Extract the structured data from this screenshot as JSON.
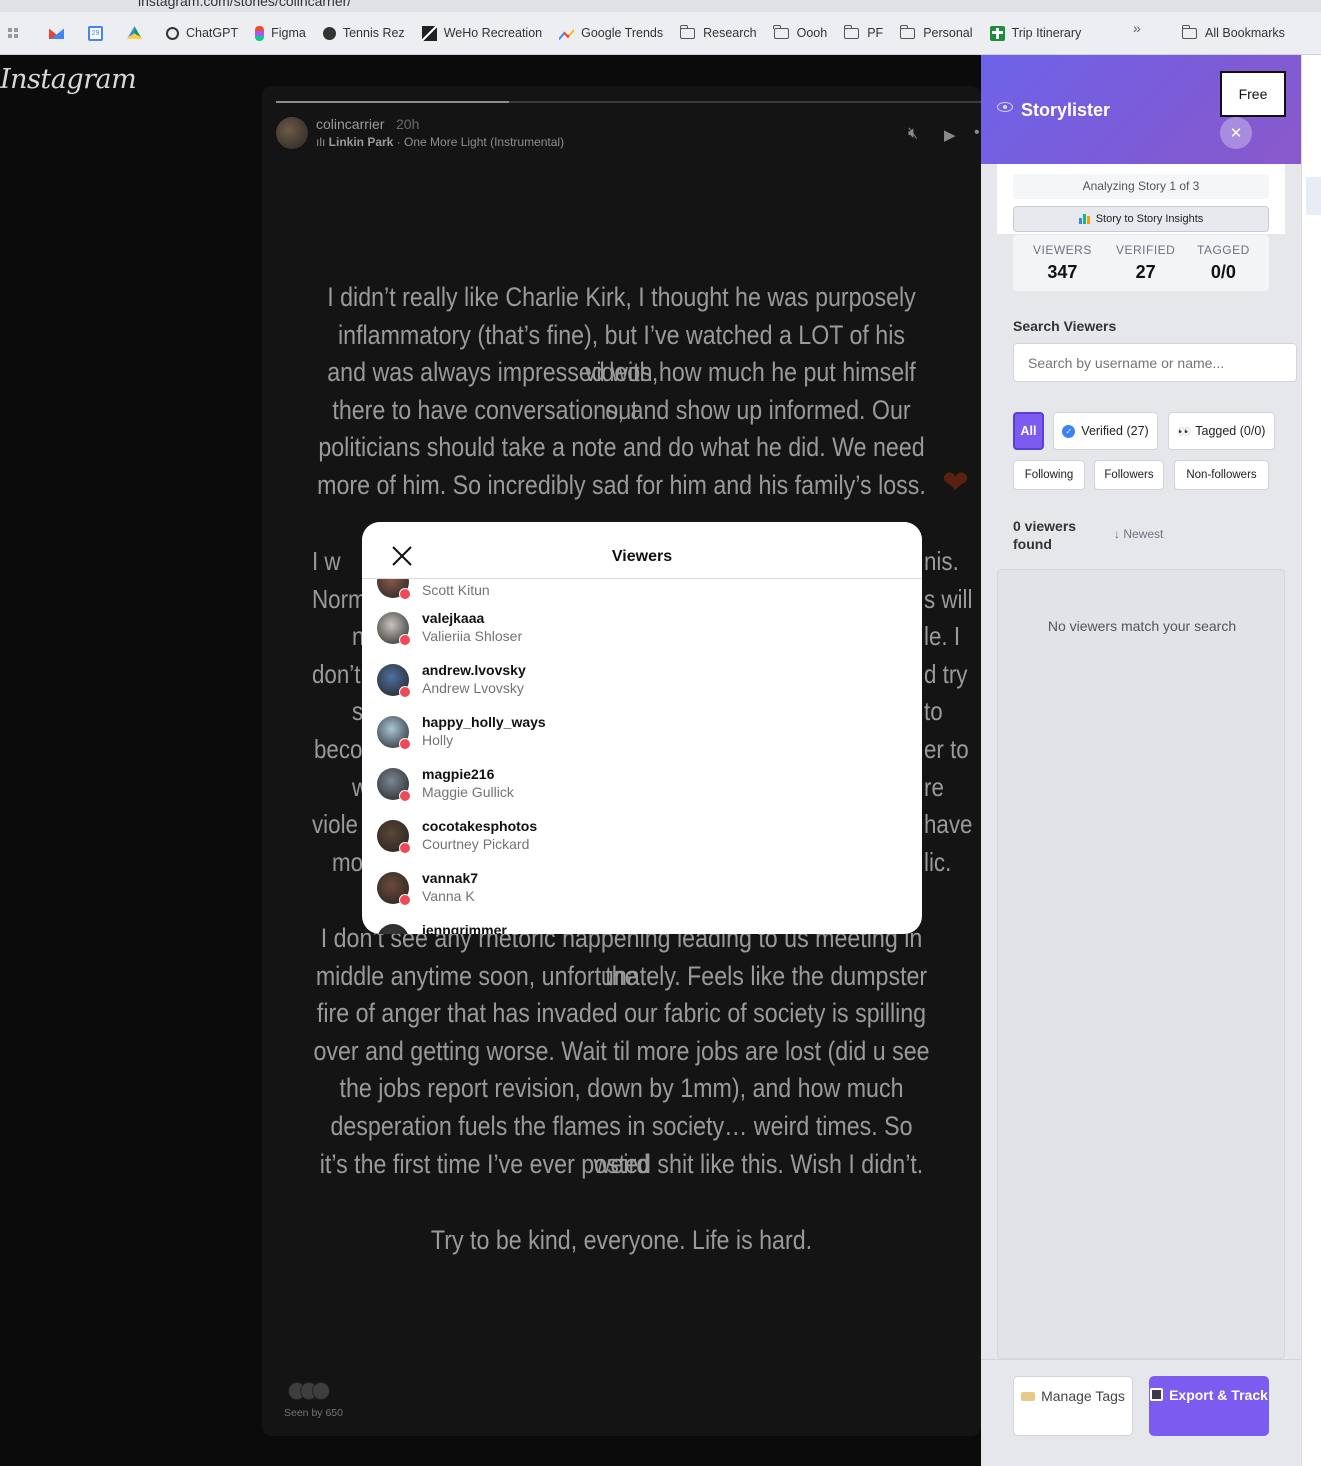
{
  "browser": {
    "url": "instagram.com/stories/colincarrier/",
    "bookmarks": [
      {
        "label": "",
        "icon": "gmail-icon"
      },
      {
        "label": "",
        "icon": "calendar-icon"
      },
      {
        "label": "",
        "icon": "drive-icon"
      },
      {
        "label": "ChatGPT",
        "icon": "chatgpt-icon"
      },
      {
        "label": "Figma",
        "icon": "figma-icon"
      },
      {
        "label": "Tennis Rez",
        "icon": "globe-icon"
      },
      {
        "label": "WeHo Recreation",
        "icon": "weho-icon"
      },
      {
        "label": "Google Trends",
        "icon": "trends-icon"
      },
      {
        "label": "Research",
        "icon": "folder-icon"
      },
      {
        "label": "Oooh",
        "icon": "folder-icon"
      },
      {
        "label": "PF",
        "icon": "folder-icon"
      },
      {
        "label": "Personal",
        "icon": "folder-icon"
      },
      {
        "label": "Trip Itinerary",
        "icon": "trip-icon"
      }
    ],
    "more": "»",
    "all_bookmarks": "All Bookmarks"
  },
  "instagram": {
    "logo": "Instagram",
    "story": {
      "username": "colincarrier",
      "time": "20h",
      "music_artist": "Linkin Park",
      "music_track": " · One More Light (Instrumental)",
      "progress": 0.33,
      "paragraph1": [
        "I didn’t really like Charlie Kirk, I thought he was purposely",
        "inflammatory (that’s fine), but I’ve watched a LOT of his videos,",
        "and was always impressed with how much he put himself out",
        "there to have conversations, and show up informed. Our",
        "politicians should take a note and do what he did.  We need",
        "more of him. So incredibly sad for him and his family’s loss."
      ],
      "heart": "❤",
      "paragraph2_fragments": {
        "left": [
          "I w",
          "Norm",
          "now",
          "don’t",
          "so",
          "beco",
          "w",
          "viole",
          "mo"
        ],
        "right": [
          "nis.",
          "s will",
          "le. I",
          "d try",
          "to",
          "er to",
          "re",
          "have",
          "lic."
        ]
      },
      "paragraph3": [
        "I don’t see any rhetoric happening leading to us meeting in the",
        "middle anytime soon, unfortunately.  Feels like the dumpster",
        "fire of anger that has invaded our fabric of society is spilling",
        "over and getting worse. Wait til more jobs are lost (did u see",
        "the jobs report revision, down by 1mm), and how much",
        "desperation fuels the flames in society… weird times. So weird",
        "it’s the first time I’ve ever posted shit like this. Wish I didn’t."
      ],
      "closing": "Try to be kind, everyone. Life is hard.",
      "seen_by": "Seen by 650"
    },
    "viewers_modal": {
      "title": "Viewers",
      "viewers": [
        {
          "username": "",
          "name": "Scott Kitun",
          "color": "#8a5a4a"
        },
        {
          "username": "valejkaaa",
          "name": "Valieriia Shloser",
          "color": "#c9c3bd"
        },
        {
          "username": "andrew.lvovsky",
          "name": "Andrew Lvovsky",
          "color": "#4e6f9c"
        },
        {
          "username": "happy_holly_ways",
          "name": "Holly",
          "color": "#a9c6d8"
        },
        {
          "username": "magpie216",
          "name": "Maggie Gullick",
          "color": "#7a8794"
        },
        {
          "username": "cocotakesphotos",
          "name": "Courtney Pickard",
          "color": "#5b4536"
        },
        {
          "username": "vannak7",
          "name": "Vanna K",
          "color": "#6b4a3a"
        },
        {
          "username": "jenngrimmer",
          "name": "",
          "color": "#3a3a3a"
        }
      ]
    }
  },
  "storylister": {
    "title": "Storylister",
    "plan": "Free",
    "close": "✕",
    "analyzing": "Analyzing Story 1 of 3",
    "insights_button": "Story to Story Insights",
    "stats": [
      {
        "key": "VIEWERS",
        "value": "347"
      },
      {
        "key": "VERIFIED",
        "value": "27"
      },
      {
        "key": "TAGGED",
        "value": "0/0"
      }
    ],
    "search_label": "Search Viewers",
    "search_placeholder": "Search by username or name...",
    "filters": {
      "all": "All",
      "verified": "Verified (27)",
      "tagged_emoji": "👀",
      "tagged": "Tagged (0/0)",
      "following": "Following",
      "followers": "Followers",
      "non_followers": "Non-followers"
    },
    "found": "0 viewers found",
    "sort": "↓ Newest",
    "empty": "No viewers match your search",
    "manage_tags": "Manage Tags",
    "export_track": "Export & Track",
    "colors": {
      "accent": "#7c5cf0",
      "header_start": "#6d63e8",
      "header_end": "#8a5acb"
    }
  }
}
